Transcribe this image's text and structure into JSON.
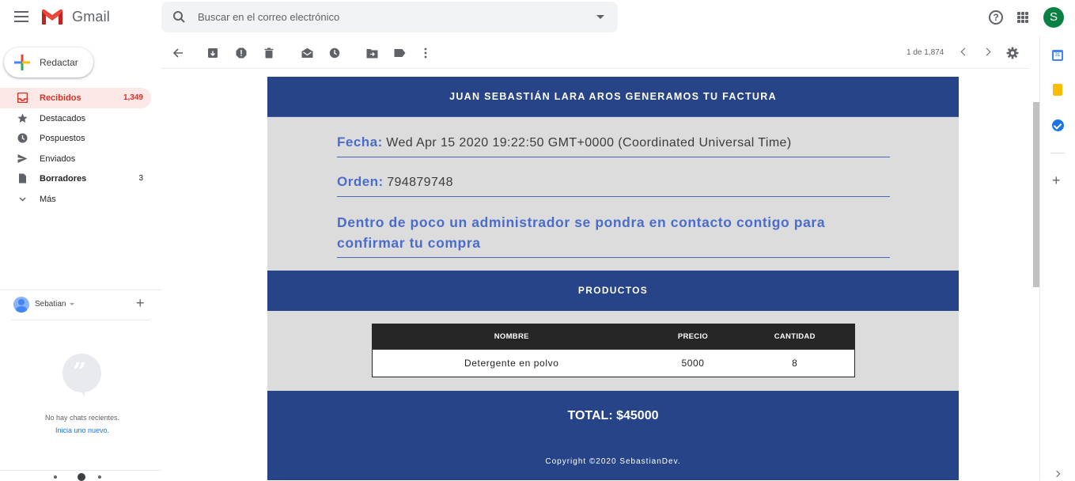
{
  "header": {
    "app_name": "Gmail",
    "search_placeholder": "Buscar en el correo electrónico",
    "avatar_letter": "S",
    "colors": {
      "avatar": "#0b8043",
      "accent": "#d93025"
    }
  },
  "sidebar": {
    "compose_label": "Redactar",
    "items": [
      {
        "label": "Recibidos",
        "count": "1,349",
        "icon": "inbox-icon",
        "active": true
      },
      {
        "label": "Destacados",
        "count": "",
        "icon": "star-icon"
      },
      {
        "label": "Pospuestos",
        "count": "",
        "icon": "clock-icon"
      },
      {
        "label": "Enviados",
        "count": "",
        "icon": "send-icon"
      },
      {
        "label": "Borradores",
        "count": "3",
        "icon": "draft-icon"
      },
      {
        "label": "Más",
        "count": "",
        "icon": "chevron-down-icon"
      }
    ],
    "hangouts": {
      "user_name": "Sebatian",
      "no_chats": "No hay chats recientes.",
      "start_new": "Inicia uno nuevo."
    }
  },
  "toolbar": {
    "pager": "1 de 1,874",
    "icons": [
      "back-arrow-icon",
      "archive-icon",
      "report-spam-icon",
      "delete-icon",
      "mark-unread-icon",
      "snooze-icon",
      "move-to-icon",
      "label-icon",
      "more-vert-icon"
    ]
  },
  "email": {
    "header_title": "JUAN SEBASTIÁN LARA AROS GENERAMOS TU FACTURA",
    "fecha_label": "Fecha:",
    "fecha_value": "Wed Apr 15 2020 19:22:50 GMT+0000 (Coordinated Universal Time)",
    "orden_label": "Orden:",
    "orden_value": "794879748",
    "message_line1": "Dentro de poco un administrador se pondra en contacto contigo para",
    "message_line2": "confirmar tu compra",
    "products_title": "PRODUCTOS",
    "table": {
      "headers": [
        "NOMBRE",
        "PRECIO",
        "CANTIDAD"
      ],
      "rows": [
        [
          "Detergente en polvo",
          "5000",
          "8"
        ]
      ]
    },
    "total": "TOTAL: $45000",
    "copyright": "Copyright ©2020 SebastianDev.",
    "colors": {
      "band": "#264487",
      "panel": "#dcdcdc",
      "label": "#4a6ccb"
    }
  }
}
